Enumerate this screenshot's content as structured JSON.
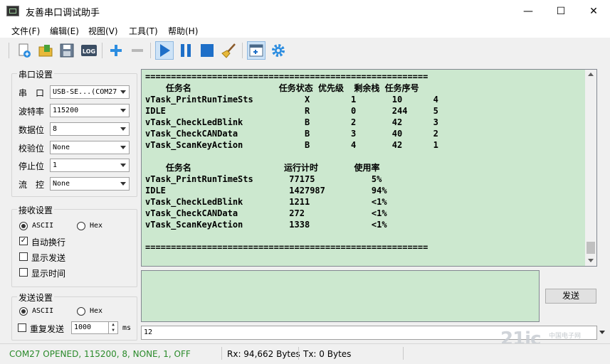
{
  "window": {
    "title": "友善串口调试助手",
    "min": "—",
    "max": "☐",
    "close": "✕"
  },
  "menu": [
    "文件(F)",
    "编辑(E)",
    "视图(V)",
    "工具(T)",
    "帮助(H)"
  ],
  "serial": {
    "group_label": "串口设置",
    "fields": [
      {
        "label": "串　口",
        "value": "USB-SE...(COM27"
      },
      {
        "label": "波特率",
        "value": "115200"
      },
      {
        "label": "数据位",
        "value": "8"
      },
      {
        "label": "校验位",
        "value": "None"
      },
      {
        "label": "停止位",
        "value": "1"
      },
      {
        "label": "流　控",
        "value": "None"
      }
    ]
  },
  "receive": {
    "group_label": "接收设置",
    "ascii": "ASCII",
    "hex": "Hex",
    "auto_newline": "自动换行",
    "show_send": "显示发送",
    "show_time": "显示时间"
  },
  "send": {
    "group_label": "发送设置",
    "ascii": "ASCII",
    "hex": "Hex",
    "repeat": "重复发送",
    "interval": "1000",
    "unit": "ms",
    "button": "发送",
    "input": "12"
  },
  "output_lines": [
    "=======================================================",
    "    任务名                 任务状态 优先级  剩余栈 任务序号",
    "vTask_PrintRunTimeSts          X        1       10      4",
    "IDLE                           R        0       244     5",
    "vTask_CheckLedBlink            B        2       42      3",
    "vTask_CheckCANData             B        3       40      2",
    "vTask_ScanKeyAction            B        4       42      1",
    "",
    "    任务名                  运行计时       使用率",
    "vTask_PrintRunTimeSts       77175           5%",
    "IDLE                        1427987         94%",
    "vTask_CheckLedBlink         1211            <1%",
    "vTask_CheckCANData          272             <1%",
    "vTask_ScanKeyAction         1338            <1%",
    "",
    "======================================================="
  ],
  "status": {
    "port": "COM27 OPENED, 115200, 8, NONE, 1, OFF",
    "rx": "Rx: 94,662 Bytes",
    "tx": "Tx: 0 Bytes"
  },
  "watermark": {
    "main": "21ic",
    "sub": "中国电子网"
  },
  "colors": {
    "output_bg": "#cce8cf",
    "status_text": "#2a8a2a",
    "accent_blue": "#1e7fd6"
  }
}
